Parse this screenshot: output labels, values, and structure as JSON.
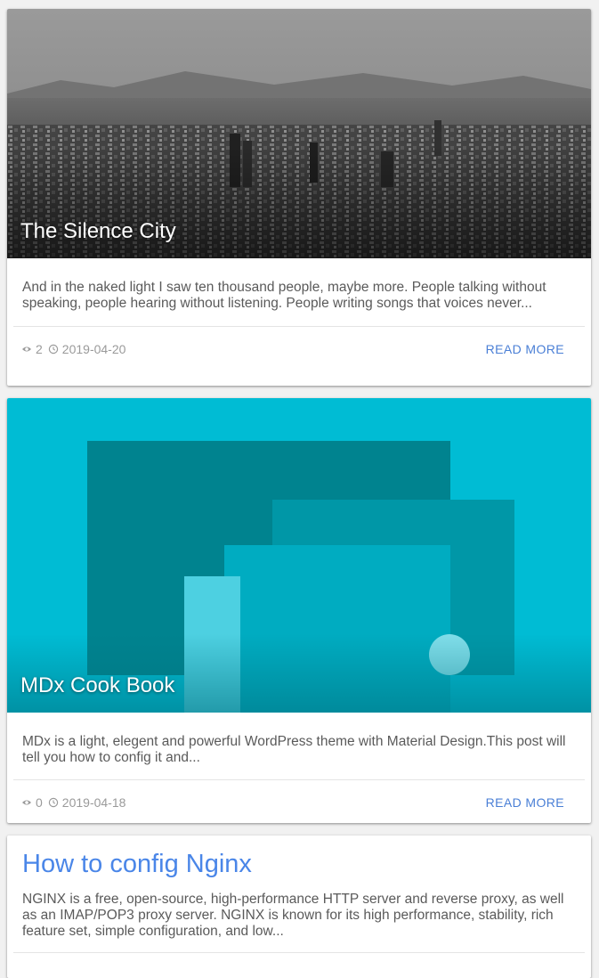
{
  "posts": [
    {
      "title": "The Silence City",
      "excerpt": "And in the naked light I saw ten thousand people, maybe more. People talking without speaking, people hearing without listening. People writing songs that voices never...",
      "views": "2",
      "date": "2019-04-20",
      "read_more": "READ MORE"
    },
    {
      "title": "MDx Cook Book",
      "excerpt": "MDx is a light, elegent and powerful WordPress theme with Material Design.This post will tell you how to config it and...",
      "views": "0",
      "date": "2019-04-18",
      "read_more": "READ MORE"
    },
    {
      "title": "How to config Nginx",
      "excerpt": "NGINX is a free, open-source, high-performance HTTP server and reverse proxy, as well as an IMAP/POP3 proxy server. NGINX is known for its high performance, stability, rich feature set, simple configuration, and low..."
    }
  ],
  "colors": {
    "link": "#4a86e8",
    "read_more": "#4a7fd6",
    "cookbook_bg": "#00bcd4"
  },
  "icons": {
    "views": "eye-icon",
    "date": "clock-icon"
  }
}
